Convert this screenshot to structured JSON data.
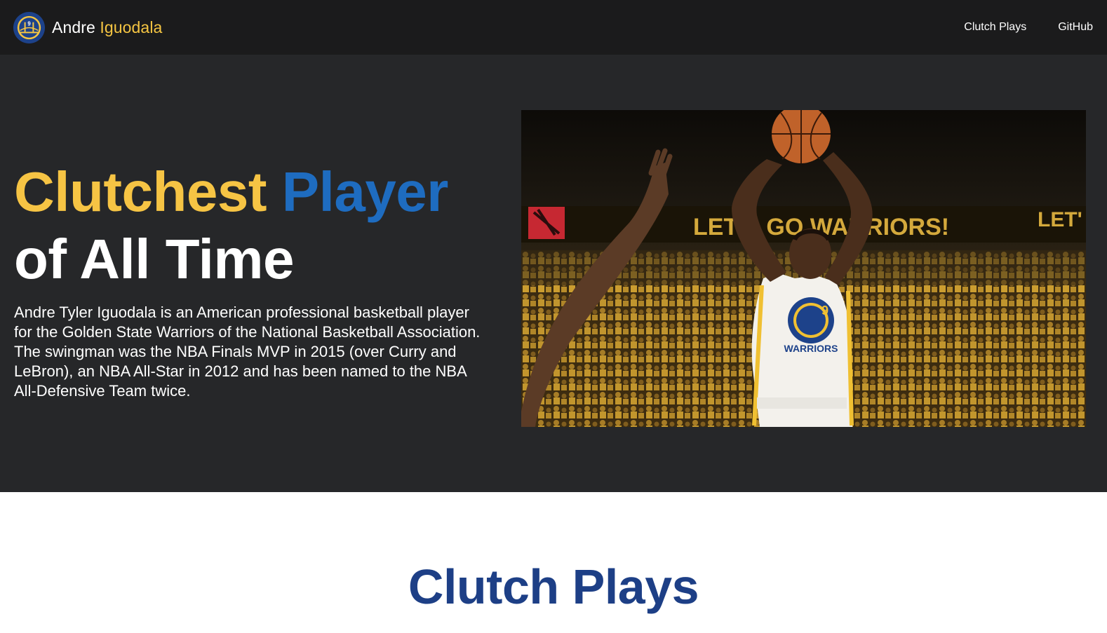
{
  "brand": {
    "first_name": "Andre",
    "last_name": "Iguodala",
    "logo_text": "GOLDEN STATE WARRIORS",
    "logo_number": "9"
  },
  "nav": {
    "items": [
      {
        "label": "Clutch Plays"
      },
      {
        "label": "GitHub"
      }
    ]
  },
  "hero": {
    "headline_word1": "Clutchest",
    "headline_word2": "Player",
    "headline_line2": "of All Time",
    "bio": "Andre Tyler Iguodala is an American professional basketball player for the Golden State Warriors of the National Basketball Association. The swingman was the NBA Finals MVP in 2015 (over Curry and LeBron), an NBA All-Star in 2012 and has been named to the NBA All-Defensive Team twice.",
    "photo": {
      "banner_text": "LET'S GO WARRIORS!",
      "banner_text_right": "LET'",
      "jersey_text": "WARRIORS",
      "jersey_number": "9"
    }
  },
  "sections": {
    "clutch_plays_title": "Clutch Plays"
  },
  "colors": {
    "navbar_bg": "#1b1b1c",
    "hero_bg": "#262729",
    "gold": "#f6c444",
    "blue": "#1e6cc0",
    "section_title": "#1d3f86"
  }
}
